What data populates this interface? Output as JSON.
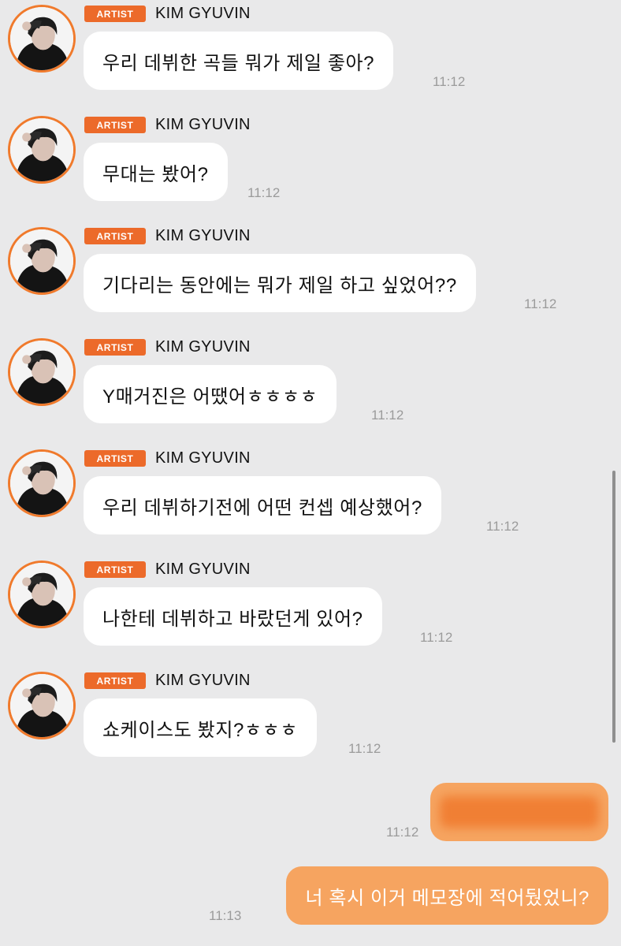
{
  "colors": {
    "background": "#e9e9ea",
    "badge": "#ec6a2a",
    "avatar_ring": "#f07a2c",
    "my_bubble": "#f6a460",
    "their_bubble": "#ffffff",
    "timestamp": "#9b9b9b"
  },
  "messages": [
    {
      "badge": "ARTIST",
      "sender": "KIM GYUVIN",
      "text": "우리 데뷔한 곡들 뭐가 제일 좋아?",
      "time": "11:12"
    },
    {
      "badge": "ARTIST",
      "sender": "KIM GYUVIN",
      "text": "무대는 봤어?",
      "time": "11:12"
    },
    {
      "badge": "ARTIST",
      "sender": "KIM GYUVIN",
      "text": "기다리는 동안에는 뭐가 제일 하고 싶었어??",
      "time": "11:12"
    },
    {
      "badge": "ARTIST",
      "sender": "KIM GYUVIN",
      "text": "Y매거진은 어땠어ㅎㅎㅎㅎ",
      "time": "11:12"
    },
    {
      "badge": "ARTIST",
      "sender": "KIM GYUVIN",
      "text": "우리 데뷔하기전에 어떤 컨셉 예상했어?",
      "time": "11:12"
    },
    {
      "badge": "ARTIST",
      "sender": "KIM GYUVIN",
      "text": "나한테 데뷔하고 바랐던게 있어?",
      "time": "11:12"
    },
    {
      "badge": "ARTIST",
      "sender": "KIM GYUVIN",
      "text": "쇼케이스도 봤지?ㅎㅎㅎ",
      "time": "11:12"
    }
  ],
  "my_messages": [
    {
      "text": "",
      "time": "11:12",
      "censored": true
    },
    {
      "text": "너 혹시 이거 메모장에 적어뒀었니?",
      "time": "11:13",
      "censored": false
    }
  ]
}
